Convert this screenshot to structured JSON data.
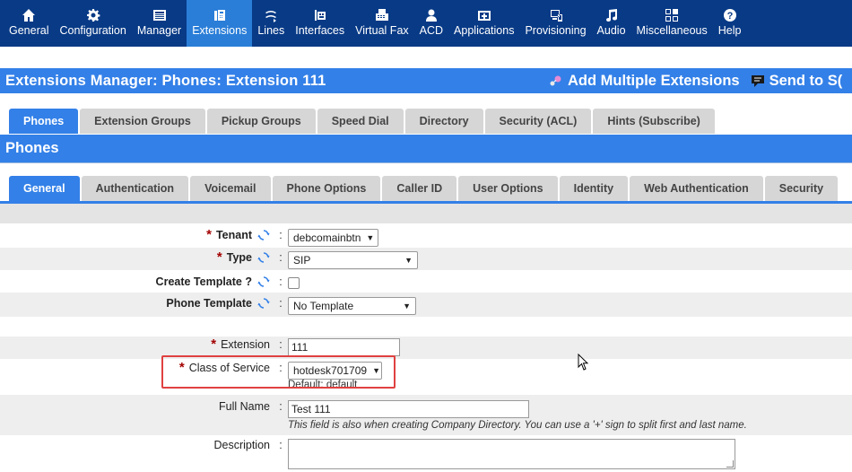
{
  "topnav": {
    "items": [
      {
        "label": "General",
        "icon": "home-icon",
        "active": false
      },
      {
        "label": "Configuration",
        "icon": "gear-icon",
        "active": false
      },
      {
        "label": "Manager",
        "icon": "manager-icon",
        "active": false
      },
      {
        "label": "Extensions",
        "icon": "extensions-icon",
        "active": true
      },
      {
        "label": "Lines",
        "icon": "lines-icon",
        "active": false
      },
      {
        "label": "Interfaces",
        "icon": "interfaces-icon",
        "active": false
      },
      {
        "label": "Virtual Fax",
        "icon": "fax-icon",
        "active": false
      },
      {
        "label": "ACD",
        "icon": "acd-icon",
        "active": false
      },
      {
        "label": "Applications",
        "icon": "applications-icon",
        "active": false
      },
      {
        "label": "Provisioning",
        "icon": "provisioning-icon",
        "active": false
      },
      {
        "label": "Audio",
        "icon": "audio-icon",
        "active": false
      },
      {
        "label": "Miscellaneous",
        "icon": "miscellaneous-icon",
        "active": false
      },
      {
        "label": "Help",
        "icon": "help-icon",
        "active": false
      }
    ]
  },
  "titlebar": {
    "title": "Extensions Manager:  Phones:  Extension 111",
    "add_multiple": "Add Multiple Extensions",
    "send_to": "Send to S("
  },
  "tabs_main": {
    "items": [
      "Phones",
      "Extension Groups",
      "Pickup Groups",
      "Speed Dial",
      "Directory",
      "Security (ACL)",
      "Hints (Subscribe)"
    ],
    "active_index": 0
  },
  "section": {
    "title": "Phones"
  },
  "tabs_sub": {
    "items": [
      "General",
      "Authentication",
      "Voicemail",
      "Phone Options",
      "Caller ID",
      "User Options",
      "Identity",
      "Web Authentication",
      "Security"
    ],
    "active_index": 0
  },
  "form": {
    "tenant": {
      "label": "Tenant",
      "value": "debcomainbtn"
    },
    "type": {
      "label": "Type",
      "value": "SIP"
    },
    "create_template": {
      "label": "Create Template ?",
      "checked": false
    },
    "phone_template": {
      "label": "Phone Template",
      "value": "No Template"
    },
    "extension": {
      "label": "Extension",
      "value": "111"
    },
    "class_of_service": {
      "label": "Class of Service",
      "value": "hotdesk701709",
      "help": "Default: default"
    },
    "full_name": {
      "label": "Full Name",
      "value": "Test 111",
      "help": "This field is also when creating Company Directory. You can use a '+' sign to split first and last name."
    },
    "description": {
      "label": "Description",
      "value": ""
    },
    "colon": ":"
  },
  "colors": {
    "nav_bg": "#083a86",
    "accent": "#3380e8",
    "required": "#a30000",
    "highlight": "#e04040"
  }
}
